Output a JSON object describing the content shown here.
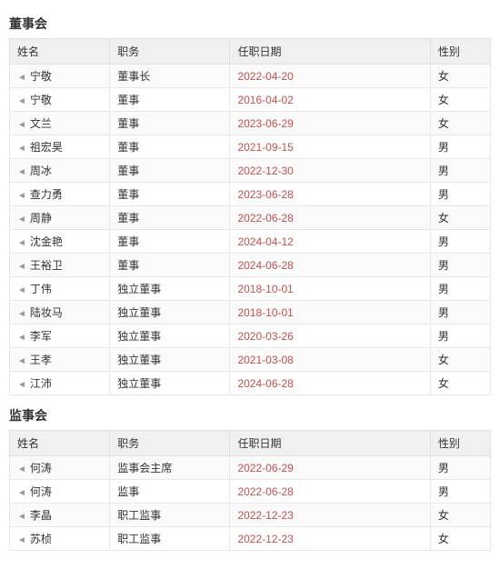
{
  "board_section": {
    "title": "董事会",
    "headers": [
      "姓名",
      "职务",
      "任职日期",
      "性别"
    ],
    "rows": [
      {
        "name": "宁敬",
        "role": "董事长",
        "date": "2022-04-20",
        "gender": "女"
      },
      {
        "name": "宁敬",
        "role": "董事",
        "date": "2016-04-02",
        "gender": "女"
      },
      {
        "name": "文兰",
        "role": "董事",
        "date": "2023-06-29",
        "gender": "女"
      },
      {
        "name": "祖宏昊",
        "role": "董事",
        "date": "2021-09-15",
        "gender": "男"
      },
      {
        "name": "周冰",
        "role": "董事",
        "date": "2022-12-30",
        "gender": "男"
      },
      {
        "name": "查力勇",
        "role": "董事",
        "date": "2023-06-28",
        "gender": "男"
      },
      {
        "name": "周静",
        "role": "董事",
        "date": "2022-06-28",
        "gender": "女"
      },
      {
        "name": "沈金艳",
        "role": "董事",
        "date": "2024-04-12",
        "gender": "男"
      },
      {
        "name": "王裕卫",
        "role": "董事",
        "date": "2024-06-28",
        "gender": "男"
      },
      {
        "name": "丁伟",
        "role": "独立董事",
        "date": "2018-10-01",
        "gender": "男"
      },
      {
        "name": "陆妆马",
        "role": "独立董事",
        "date": "2018-10-01",
        "gender": "男"
      },
      {
        "name": "李军",
        "role": "独立董事",
        "date": "2020-03-26",
        "gender": "男"
      },
      {
        "name": "王孝",
        "role": "独立董事",
        "date": "2021-03-08",
        "gender": "女"
      },
      {
        "name": "江沛",
        "role": "独立董事",
        "date": "2024-06-28",
        "gender": "女"
      }
    ]
  },
  "supervisory_section": {
    "title": "监事会",
    "headers": [
      "姓名",
      "职务",
      "任职日期",
      "性别"
    ],
    "rows": [
      {
        "name": "何涛",
        "role": "监事会主席",
        "date": "2022-06-29",
        "gender": "男"
      },
      {
        "name": "何涛",
        "role": "监事",
        "date": "2022-06-28",
        "gender": "男"
      },
      {
        "name": "李晶",
        "role": "职工监事",
        "date": "2022-12-23",
        "gender": "女"
      },
      {
        "name": "苏桢",
        "role": "职工监事",
        "date": "2022-12-23",
        "gender": "女"
      }
    ]
  },
  "icons": {
    "arrow": "◄"
  }
}
